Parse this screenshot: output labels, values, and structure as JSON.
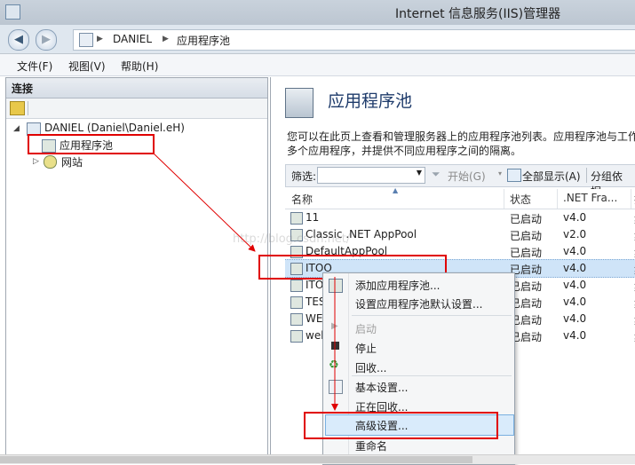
{
  "window": {
    "title": "Internet 信息服务(IIS)管理器"
  },
  "address": {
    "crumbs": [
      "DANIEL",
      "应用程序池"
    ],
    "separator": "▶"
  },
  "menu": [
    "文件(F)",
    "视图(V)",
    "帮助(H)"
  ],
  "connections": {
    "header": "连接",
    "server": "DANIEL (Daniel\\Daniel.eH)",
    "app_pools": "应用程序池",
    "sites": "网站"
  },
  "page": {
    "title": "应用程序池",
    "desc_line1": "您可以在此页上查看和管理服务器上的应用程序池列表。应用程序池与工作",
    "desc_line2": "多个应用程序，并提供不同应用程序之间的隔离。"
  },
  "filter": {
    "label": "筛选:",
    "start": "开始(G)",
    "show_all": "全部显示(A)",
    "group_by": "分组依据:"
  },
  "list": {
    "columns": [
      "名称",
      "状态",
      ".NET Fra...",
      "托"
    ],
    "rows": [
      {
        "name": "11",
        "status": "已启动",
        "net": "v4.0",
        "mode": "集"
      },
      {
        "name": "Classic .NET AppPool",
        "status": "已启动",
        "net": "v2.0",
        "mode": "集"
      },
      {
        "name": "DefaultAppPool",
        "status": "已启动",
        "net": "v4.0",
        "mode": "集"
      },
      {
        "name": "ITOO",
        "status": "已启动",
        "net": "v4.0",
        "mode": "集"
      },
      {
        "name": "ITO",
        "status": "已启动",
        "net": "v4.0",
        "mode": "集"
      },
      {
        "name": "TES",
        "status": "已启动",
        "net": "v4.0",
        "mode": "集"
      },
      {
        "name": "WE",
        "status": "已启动",
        "net": "v4.0",
        "mode": "集"
      },
      {
        "name": "web",
        "status": "已启动",
        "net": "v4.0",
        "mode": "集"
      }
    ]
  },
  "context_menu": {
    "add": "添加应用程序池...",
    "defaults": "设置应用程序池默认设置...",
    "start": "启动",
    "stop": "停止",
    "recycle": "回收...",
    "basic": "基本设置...",
    "recycling": "正在回收...",
    "advanced": "高级设置...",
    "rename": "重命名"
  },
  "watermark": "http://blog.csdn.net/",
  "colors": {
    "annotation_red": "#e00000",
    "selection": "#cfe4f8",
    "title_blue": "#1e3b6b"
  }
}
